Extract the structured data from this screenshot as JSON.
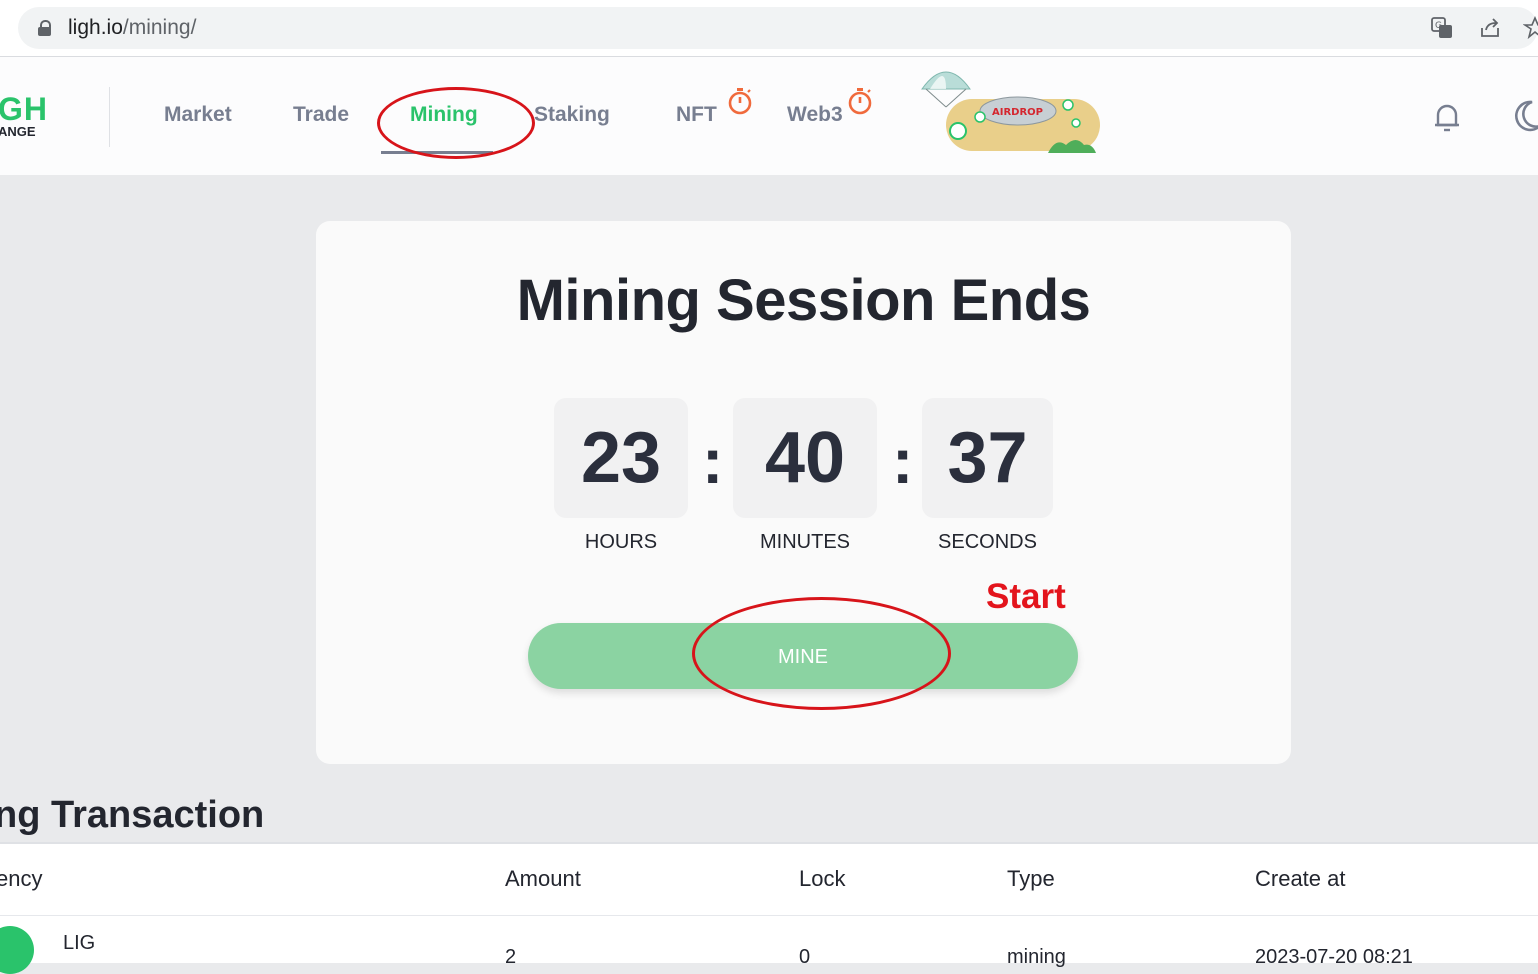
{
  "browser": {
    "url_host": "ligh.io",
    "url_path": "/mining/"
  },
  "header": {
    "logo_top": "GH",
    "logo_bottom": "ANGE",
    "nav": [
      {
        "label": "Market"
      },
      {
        "label": "Trade"
      },
      {
        "label": "Mining"
      },
      {
        "label": "Staking"
      },
      {
        "label": "NFT"
      },
      {
        "label": "Web3"
      }
    ],
    "banner_text": "AIRDROP"
  },
  "mining": {
    "title": "Mining Session Ends",
    "hours": "23",
    "minutes": "40",
    "seconds": "37",
    "separator": ":",
    "hours_label": "HOURS",
    "minutes_label": "MINUTES",
    "seconds_label": "SECONDS",
    "mine_button": "MINE",
    "annotation": "Start"
  },
  "transactions": {
    "title": "ng Transaction",
    "columns": [
      "ency",
      "Amount",
      "Lock",
      "Type",
      "Create at"
    ],
    "rows": [
      {
        "currency": "LIG",
        "amount": "2",
        "lock": "0",
        "type": "mining",
        "created": "2023-07-20 08:21"
      }
    ]
  },
  "colors": {
    "brand_green": "#2ac36b",
    "button_green": "#8bd3a2",
    "annotation_red": "#d7141a",
    "timer_orange": "#f06a3c"
  }
}
